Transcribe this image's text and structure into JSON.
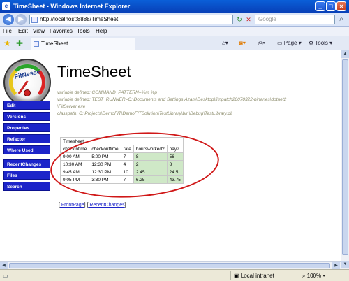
{
  "window": {
    "title": "TimeSheet - Windows Internet Explorer"
  },
  "address": {
    "url": "http://localhost:8888/TimeSheet",
    "search_placeholder": "Google"
  },
  "menu": [
    "File",
    "Edit",
    "View",
    "Favorites",
    "Tools",
    "Help"
  ],
  "tab": {
    "label": "TimeSheet"
  },
  "toolbar": {
    "page_label": "Page",
    "tools_label": "Tools"
  },
  "logo": {
    "text": "FitNesse"
  },
  "page": {
    "title": "TimeSheet"
  },
  "sidebar": {
    "items": [
      "Edit",
      "Versions",
      "Properties",
      "Refactor",
      "Where Used",
      "RecentChanges",
      "Files",
      "Search"
    ]
  },
  "variables": [
    "variable defined: COMMAND_PATTERN=%m %p",
    "variable defined: TEST_RUNNER=C:\\Documents and Settings\\Azam\\Desktop\\fitnpatch20070322-binaries\\dotnet2",
    "\\FitServer.exe",
    "classpath: C:\\Projects\\DemoFIT\\DemoFITSolution\\TestLibrary\\bin\\Debug\\TestLibrary.dll"
  ],
  "table": {
    "caption": "Timesheet",
    "headers": [
      "checkintime",
      "checkouttime",
      "rate",
      "hoursworked?",
      "pay?"
    ],
    "rows": [
      [
        "9:00 AM",
        "5:00 PM",
        "7",
        "8",
        "56"
      ],
      [
        "10:30 AM",
        "12:30 PM",
        "4",
        "2",
        "8"
      ],
      [
        "9:45 AM",
        "12:30 PM",
        "10",
        "2.45",
        "24.5"
      ],
      [
        "9:05 PM",
        "3:30 PM",
        "7",
        "6.25",
        "43.75"
      ]
    ]
  },
  "footer": {
    "front_page": ".FrontPage",
    "recent_changes": ".RecentChanges"
  },
  "status": {
    "zone": "Local intranet",
    "zoom": "100%"
  },
  "colors": {
    "sidebar_bg": "#1c24c9",
    "annotation": "#d01818",
    "pass_cell": "#cfe8c7"
  }
}
